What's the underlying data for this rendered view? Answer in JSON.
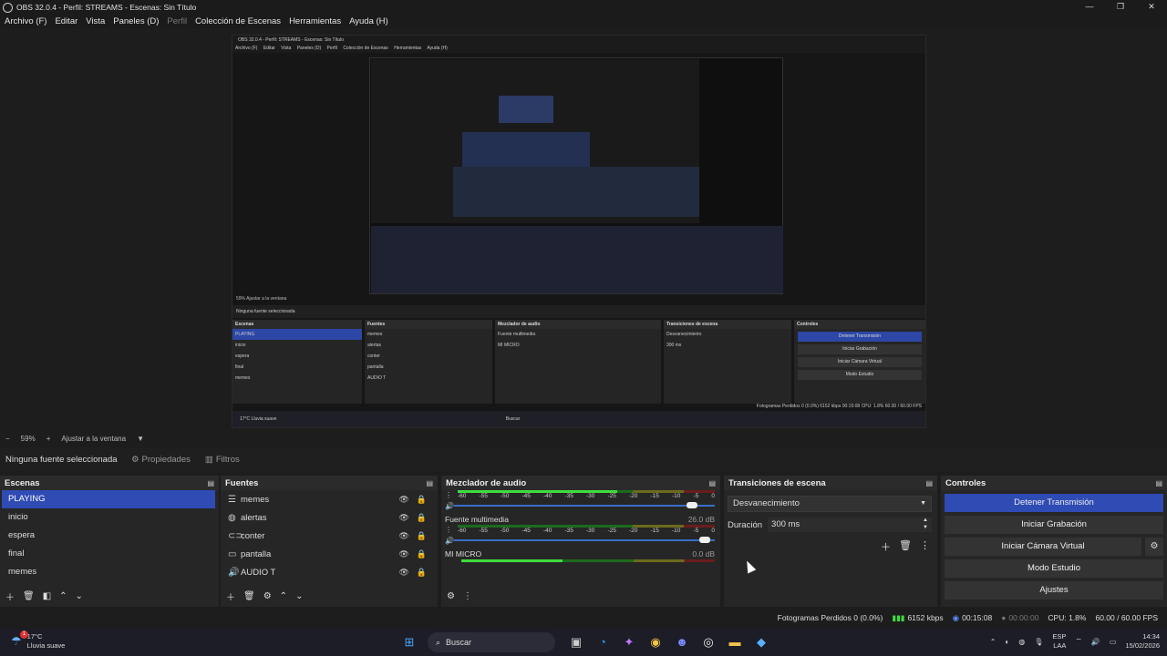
{
  "window": {
    "title": "OBS 32.0.4 - Perfil: STREAMS - Escenas: Sin Título",
    "controls": [
      "—",
      "❐",
      "✕"
    ]
  },
  "menu": [
    "Archivo (F)",
    "Editar",
    "Vista",
    "Paneles (D)",
    "Perfil",
    "Colección de Escenas",
    "Herramientas",
    "Ayuda (H)"
  ],
  "zoom": {
    "minus": "−",
    "value": "59%",
    "plus": "+",
    "fit": "Ajustar a la ventana",
    "arrow": "▼"
  },
  "propsbar": {
    "no_source": "Ninguna fuente seleccionada",
    "properties": "Propiedades",
    "filters": "Filtros"
  },
  "scenes": {
    "title": "Escenas",
    "items": [
      "PLAYING",
      "inicio",
      "espera",
      "final",
      "memes"
    ],
    "selected": 0
  },
  "sources": {
    "title": "Fuentes",
    "items": [
      {
        "name": "memes",
        "icon": "list-icon"
      },
      {
        "name": "alertas",
        "icon": "browser-icon"
      },
      {
        "name": "conter",
        "icon": "link-icon"
      },
      {
        "name": "pantalla",
        "icon": "display-icon"
      },
      {
        "name": "AUDIO T",
        "icon": "speaker-icon"
      }
    ]
  },
  "mixer": {
    "title": "Mezclador de audio",
    "ticks": [
      "-60",
      "-55",
      "-50",
      "-45",
      "-40",
      "-35",
      "-30",
      "-25",
      "-20",
      "-15",
      "-10",
      "-5",
      "0"
    ],
    "channels": [
      {
        "name": "",
        "db": "",
        "level": 0.62,
        "fader": 0.93
      },
      {
        "name": "Fuente multimedia",
        "db": "26.0 dB",
        "level": 0.0,
        "fader": 0.98
      },
      {
        "name": "MI MICRO",
        "db": "0.0 dB",
        "level": 0.4,
        "fader": 0.0
      }
    ]
  },
  "transitions": {
    "title": "Transiciones de escena",
    "selected": "Desvanecimiento",
    "duration_label": "Duración",
    "duration_value": "300 ms"
  },
  "controls": {
    "title": "Controles",
    "stop_stream": "Detener Transmisión",
    "start_recording": "Iniciar Grabación",
    "virtual_cam": "Iniciar Cámara Virtual",
    "studio_mode": "Modo Estudio",
    "settings": "Ajustes"
  },
  "status": {
    "dropped_frames": "Fotogramas Perdidos 0 (0.0%)",
    "bitrate": "6152 kbps",
    "stream_time": "00:15:08",
    "rec_time": "00:00:00",
    "cpu": "CPU: 1.8%",
    "fps": "60.00 / 60.00 FPS"
  },
  "taskbar": {
    "weather_temp": "17°C",
    "weather_desc": "Lluvia suave",
    "weather_badge": "1",
    "search": "Buscar",
    "lang": "ESP",
    "lang_sub": "LAA",
    "time": "14:34",
    "date": "15/02/2026"
  },
  "nested": {
    "title": "OBS 32.0.4 - Perfil: STREAMS - Escenas: Sin Título",
    "menu": [
      "Archivo (F)",
      "Editar",
      "Vista",
      "Paneles (D)",
      "Perfil",
      "Colección de Escenas",
      "Herramientas",
      "Ayuda (H)"
    ],
    "zoom": "59%   Ajustar a la ventana",
    "props": "Ninguna fuente seleccionada",
    "status": "Fotogramas Perdidos 0 (0.0%)   6152 kbps   00:15:08   CPU: 1.8%   60.00 / 60.00 FPS",
    "task": "17°C Lluvia suave",
    "task_search": "Buscar"
  },
  "colors": {
    "accent": "#2f4bb4",
    "meter_green": "#3ddd3d",
    "bg": "#1d1d1d"
  }
}
